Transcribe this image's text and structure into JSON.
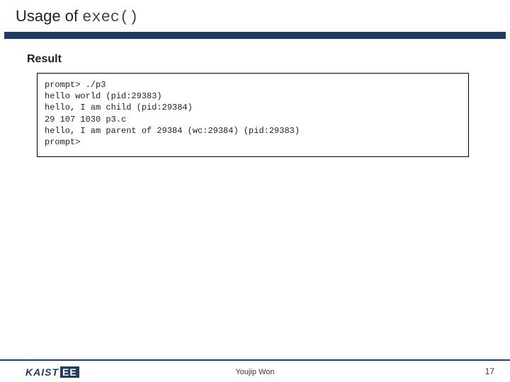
{
  "title": {
    "prefix": "Usage of ",
    "code": "exec()"
  },
  "section": {
    "heading": "Result",
    "terminal": "prompt> ./p3\nhello world (pid:29383)\nhello, I am child (pid:29384)\n29 107 1030 p3.c\nhello, I am parent of 29384 (wc:29384) (pid:29383)\nprompt>"
  },
  "footer": {
    "logo_main": "KAIST",
    "logo_suffix": "EE",
    "author": "Youjip Won",
    "page": "17"
  }
}
